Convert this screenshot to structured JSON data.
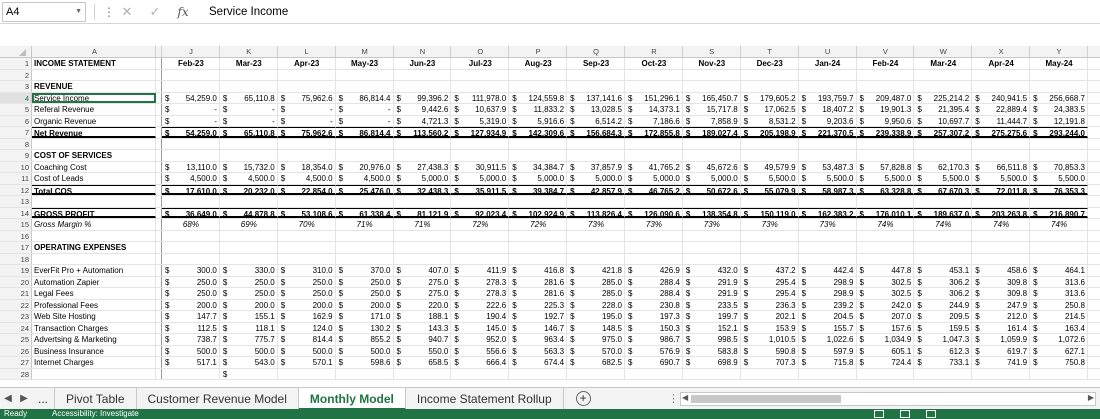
{
  "formula_bar": {
    "name_box": "A4",
    "content": "Service Income"
  },
  "columns": [
    "A",
    "J",
    "K",
    "L",
    "M",
    "N",
    "O",
    "P",
    "Q",
    "R",
    "S",
    "T",
    "U",
    "V",
    "W",
    "X",
    "Y"
  ],
  "rows": [
    {
      "n": "1",
      "label": "INCOME STATEMENT",
      "style": "bold",
      "type": "months",
      "values": [
        "Feb-23",
        "Mar-23",
        "Apr-23",
        "May-23",
        "Jun-23",
        "Jul-23",
        "Aug-23",
        "Sep-23",
        "Oct-23",
        "Nov-23",
        "Dec-23",
        "Jan-24",
        "Feb-24",
        "Mar-24",
        "Apr-24",
        "May-24"
      ]
    },
    {
      "n": "2",
      "label": "",
      "type": "blank"
    },
    {
      "n": "3",
      "label": "REVENUE",
      "style": "bold",
      "type": "blank"
    },
    {
      "n": "4",
      "label": "Service Income",
      "type": "money",
      "values": [
        "54,259.0",
        "65,110.8",
        "75,962.6",
        "86,814.4",
        "99,396.2",
        "111,978.0",
        "124,559.8",
        "137,141.6",
        "151,296.1",
        "165,450.7",
        "179,605.2",
        "193,759.7",
        "209,487.0",
        "225,214.2",
        "240,941.5",
        "256,668.7"
      ]
    },
    {
      "n": "5",
      "label": "Referal Revenue",
      "type": "money",
      "values": [
        "-",
        "-",
        "-",
        "-",
        "9,442.6",
        "10,637.9",
        "11,833.2",
        "13,028.5",
        "14,373.1",
        "15,717.8",
        "17,062.5",
        "18,407.2",
        "19,901.3",
        "21,395.4",
        "22,889.4",
        "24,383.5"
      ]
    },
    {
      "n": "6",
      "label": "Organic Revenue",
      "type": "money",
      "values": [
        "-",
        "-",
        "-",
        "-",
        "4,721.3",
        "5,319.0",
        "5,916.6",
        "6,514.2",
        "7,186.6",
        "7,858.9",
        "8,531.2",
        "9,203.6",
        "9,950.6",
        "10,697.7",
        "11,444.7",
        "12,191.8"
      ]
    },
    {
      "n": "7",
      "label": "Net Revenue",
      "style": "bold",
      "border": "top-dbl",
      "type": "money",
      "values": [
        "54,259.0",
        "65,110.8",
        "75,962.6",
        "86,814.4",
        "113,560.2",
        "127,934.9",
        "142,309.6",
        "156,684.3",
        "172,855.8",
        "189,027.4",
        "205,198.9",
        "221,370.5",
        "239,338.9",
        "257,307.2",
        "275,275.6",
        "293,244.0"
      ]
    },
    {
      "n": "8",
      "label": "",
      "type": "blank"
    },
    {
      "n": "9",
      "label": "COST OF SERVICES",
      "style": "bold",
      "type": "blank"
    },
    {
      "n": "10",
      "label": "Coaching Cost",
      "type": "money",
      "values": [
        "13,110.0",
        "15,732.0",
        "18,354.0",
        "20,976.0",
        "27,438.3",
        "30,911.5",
        "34,384.7",
        "37,857.9",
        "41,765.2",
        "45,672.6",
        "49,579.9",
        "53,487.3",
        "57,828.8",
        "62,170.3",
        "66,511.8",
        "70,853.3"
      ]
    },
    {
      "n": "11",
      "label": "Cost of Leads",
      "type": "money",
      "values": [
        "4,500.0",
        "4,500.0",
        "4,500.0",
        "4,500.0",
        "5,000.0",
        "5,000.0",
        "5,000.0",
        "5,000.0",
        "5,000.0",
        "5,000.0",
        "5,500.0",
        "5,500.0",
        "5,500.0",
        "5,500.0",
        "5,500.0",
        "5,500.0"
      ]
    },
    {
      "n": "12",
      "label": "Total COS",
      "style": "bold",
      "border": "top-dbl",
      "type": "money",
      "values": [
        "17,610.0",
        "20,232.0",
        "22,854.0",
        "25,476.0",
        "32,438.3",
        "35,911.5",
        "39,384.7",
        "42,857.9",
        "46,765.2",
        "50,672.6",
        "55,079.9",
        "58,987.3",
        "63,328.8",
        "67,670.3",
        "72,011.8",
        "76,353.3"
      ]
    },
    {
      "n": "13",
      "label": "",
      "type": "blank"
    },
    {
      "n": "14",
      "label": "GROSS PROFIT",
      "style": "bold",
      "border": "top-dbl",
      "type": "money",
      "values": [
        "36,649.0",
        "44,878.8",
        "53,108.6",
        "61,338.4",
        "81,121.9",
        "92,023.4",
        "102,924.9",
        "113,826.4",
        "126,090.6",
        "138,354.8",
        "150,119.0",
        "162,383.2",
        "176,010.1",
        "189,637.0",
        "203,263.8",
        "216,890.7"
      ]
    },
    {
      "n": "15",
      "label": "Gross Margin %",
      "style": "ital",
      "type": "pct",
      "values": [
        "68%",
        "69%",
        "70%",
        "71%",
        "71%",
        "72%",
        "72%",
        "73%",
        "73%",
        "73%",
        "73%",
        "73%",
        "74%",
        "74%",
        "74%",
        "74%"
      ]
    },
    {
      "n": "16",
      "label": "",
      "type": "blank"
    },
    {
      "n": "17",
      "label": "OPERATING EXPENSES",
      "style": "bold",
      "type": "blank"
    },
    {
      "n": "18",
      "label": "",
      "type": "blank"
    },
    {
      "n": "19",
      "label": "EverFit Pro + Automation",
      "type": "money",
      "values": [
        "300.0",
        "330.0",
        "310.0",
        "370.0",
        "407.0",
        "411.9",
        "416.8",
        "421.8",
        "426.9",
        "432.0",
        "437.2",
        "442.4",
        "447.8",
        "453.1",
        "458.6",
        "464.1"
      ]
    },
    {
      "n": "20",
      "label": "Automation Zapier",
      "type": "money",
      "values": [
        "250.0",
        "250.0",
        "250.0",
        "250.0",
        "275.0",
        "278.3",
        "281.6",
        "285.0",
        "288.4",
        "291.9",
        "295.4",
        "298.9",
        "302.5",
        "306.2",
        "309.8",
        "313.6"
      ]
    },
    {
      "n": "21",
      "label": "Legal Fees",
      "type": "money",
      "values": [
        "250.0",
        "250.0",
        "250.0",
        "250.0",
        "275.0",
        "278.3",
        "281.6",
        "285.0",
        "288.4",
        "291.9",
        "295.4",
        "298.9",
        "302.5",
        "306.2",
        "309.8",
        "313.6"
      ]
    },
    {
      "n": "22",
      "label": "Professional Fees",
      "type": "money",
      "values": [
        "200.0",
        "200.0",
        "200.0",
        "200.0",
        "220.0",
        "222.6",
        "225.3",
        "228.0",
        "230.8",
        "233.5",
        "236.3",
        "239.2",
        "242.0",
        "244.9",
        "247.9",
        "250.8"
      ]
    },
    {
      "n": "23",
      "label": "Web Site Hosting",
      "type": "money",
      "values": [
        "147.7",
        "155.1",
        "162.9",
        "171.0",
        "188.1",
        "190.4",
        "192.7",
        "195.0",
        "197.3",
        "199.7",
        "202.1",
        "204.5",
        "207.0",
        "209.5",
        "212.0",
        "214.5"
      ]
    },
    {
      "n": "24",
      "label": "Transaction Charges",
      "type": "money",
      "values": [
        "112.5",
        "118.1",
        "124.0",
        "130.2",
        "143.3",
        "145.0",
        "146.7",
        "148.5",
        "150.3",
        "152.1",
        "153.9",
        "155.7",
        "157.6",
        "159.5",
        "161.4",
        "163.4"
      ]
    },
    {
      "n": "25",
      "label": "Advertsing & Marketing",
      "type": "money",
      "values": [
        "738.7",
        "775.7",
        "814.4",
        "855.2",
        "940.7",
        "952.0",
        "963.4",
        "975.0",
        "986.7",
        "998.5",
        "1,010.5",
        "1,022.6",
        "1,034.9",
        "1,047.3",
        "1,059.9",
        "1,072.6"
      ]
    },
    {
      "n": "26",
      "label": "Business Insurance",
      "type": "money",
      "values": [
        "500.0",
        "500.0",
        "500.0",
        "500.0",
        "550.0",
        "556.6",
        "563.3",
        "570.0",
        "576.9",
        "583.8",
        "590.8",
        "597.9",
        "605.1",
        "612.3",
        "619.7",
        "627.1"
      ]
    },
    {
      "n": "27",
      "label": "Internet Charges",
      "type": "money",
      "values": [
        "517.1",
        "543.0",
        "570.1",
        "598.6",
        "658.5",
        "666.4",
        "674.4",
        "682.5",
        "690.7",
        "698.9",
        "707.3",
        "715.8",
        "724.4",
        "733.1",
        "741.9",
        "750.8"
      ]
    },
    {
      "n": "28",
      "label": "",
      "type": "partial",
      "values": [
        "$"
      ]
    }
  ],
  "currency_symbol": "$",
  "sheet_tabs": {
    "more": "...",
    "tabs": [
      "Pivot Table",
      "Customer Revenue Model",
      "Monthly Model",
      "Income Statement Rollup"
    ],
    "active_index": 2,
    "add": "+"
  },
  "status_bar": {
    "left": "Ready",
    "accessibility": "Accessibility: Investigate"
  },
  "colors": {
    "accent": "#217346"
  }
}
